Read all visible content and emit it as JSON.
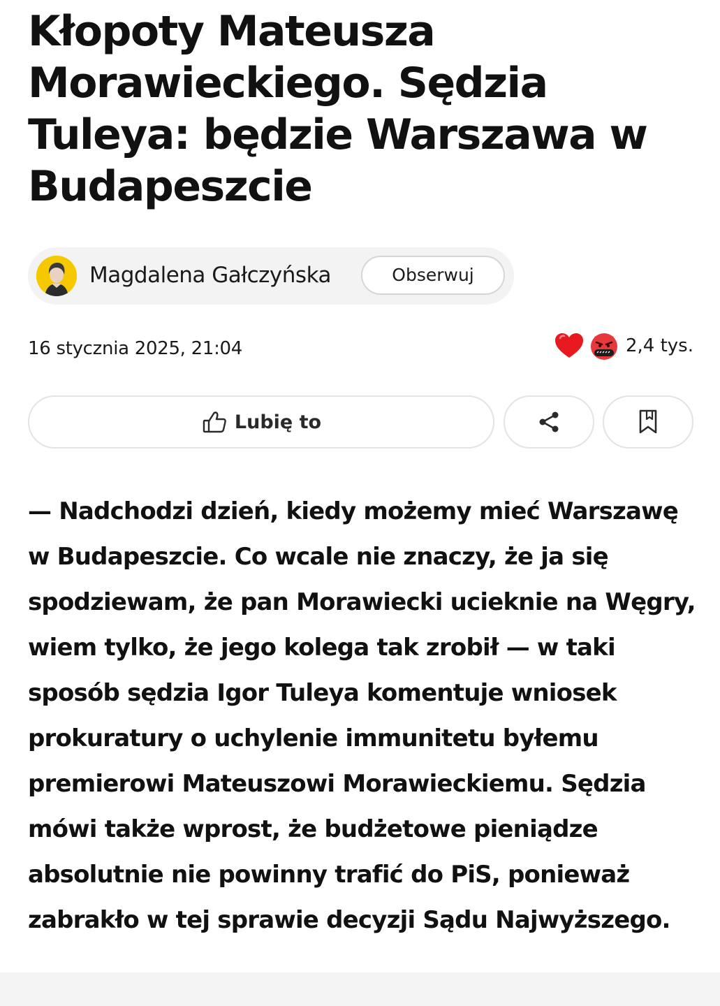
{
  "article": {
    "title": "Kłopoty Mateusza Morawieckiego. Sędzia Tuleya: będzie Warszawa w Budapeszcie",
    "lead": "— Nadchodzi dzień, kiedy możemy mieć Warszawę w Budapeszcie. Co wcale nie znaczy, że ja się spodziewam, że pan Morawiecki ucieknie na Węgry, wiem tylko, że jego kolega tak zrobił — w taki sposób sędzia Igor Tuleya komentuje wniosek prokuratury o uchylenie immunitetu byłemu premierowi Mateuszowi Morawieckiemu. Sędzia mówi także wprost, że budżetowe pieniądze absolutnie nie powinny trafić do PiS, ponieważ zabrakło w tej sprawie decyzji Sądu Najwyższego.",
    "date": "16 stycznia 2025, 21:04"
  },
  "author": {
    "name": "Magdalena Gałczyńska",
    "follow_label": "Obserwuj",
    "avatar_icon": "author-avatar"
  },
  "reactions": {
    "icons": [
      "heart-icon",
      "angry-face-icon"
    ],
    "count": "2,4 tys."
  },
  "actions": {
    "like_label": "Lubię to",
    "like_icon": "thumbs-up-icon",
    "share_icon": "share-icon",
    "bookmark_icon": "bookmark-icon"
  },
  "colors": {
    "avatar_bg": "#f5c800",
    "pill_bg": "#f3f3f3",
    "heart": "#e8191f",
    "angry": "#e5393b"
  }
}
